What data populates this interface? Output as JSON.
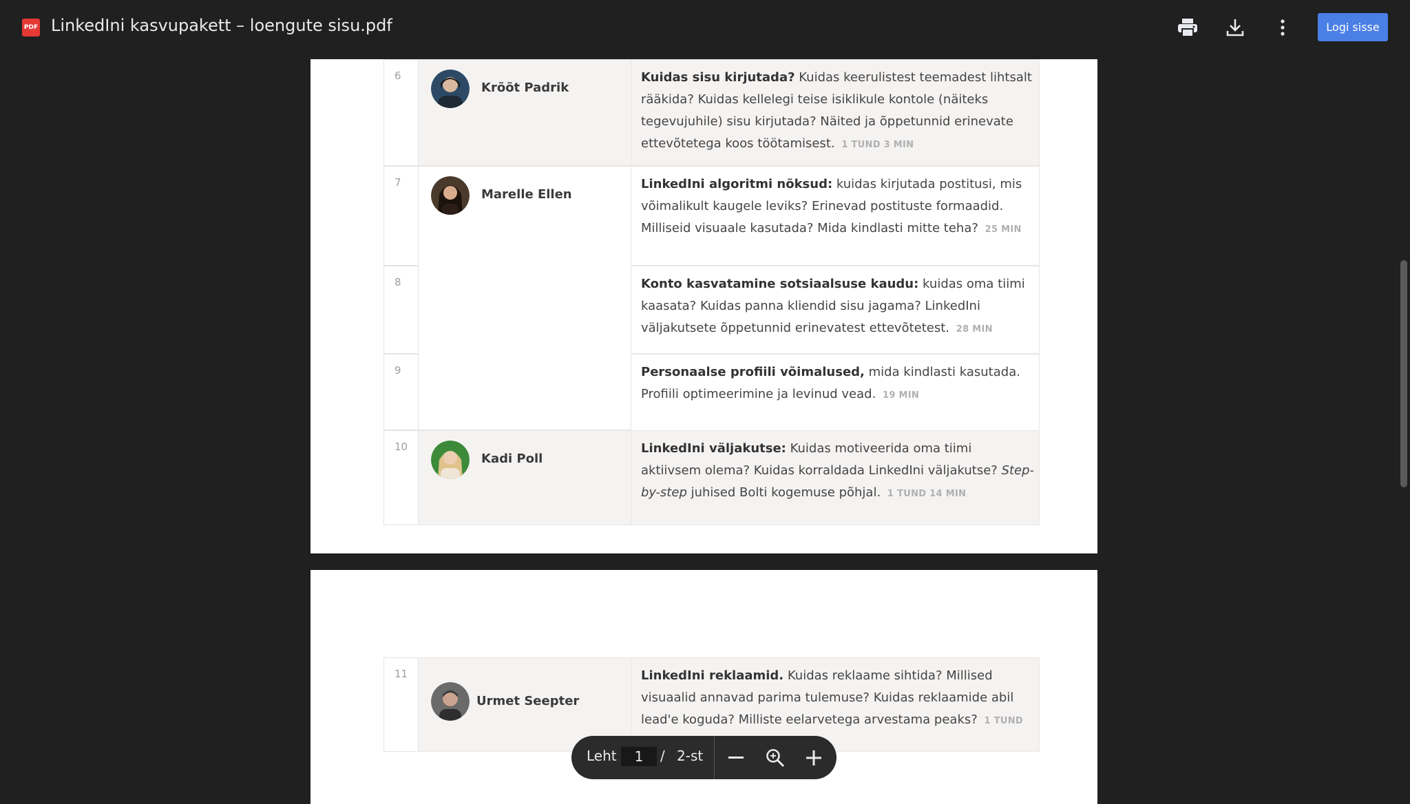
{
  "header": {
    "file_icon_text": "PDF",
    "title": "LinkedIni kasvupakett – loengute sisu.pdf",
    "print_icon": "print-icon",
    "download_icon": "download-icon",
    "more_icon": "more-vert-icon",
    "login_label": "Logi sisse"
  },
  "rows": [
    {
      "num": "6",
      "speaker": "Krõõt Padrik",
      "title": "Kuidas sisu kirjutada?",
      "text": " Kuidas keerulistest teemadest lihtsalt rääkida? Kuidas kellelegi teise isiklikule kontole (näiteks tegevujuhile) sisu kirjutada? Näited ja õppetunnid erinevate ettevõtetega koos töötamisest.",
      "duration": "1 TUND 3  MIN"
    },
    {
      "num": "7",
      "speaker": "Marelle Ellen",
      "title": "LinkedIni algoritmi nõksud:",
      "text": " kuidas kirjutada postitusi, mis võimalikult kaugele leviks? Erinevad postituste formaadid. Milliseid visuaale kasutada? Mida kindlasti mitte teha?",
      "duration": "25  MIN"
    },
    {
      "num": "8",
      "speaker": "",
      "title": "Konto kasvatamine sotsiaalsuse kaudu:",
      "text": " kuidas oma tiimi kaasata? Kuidas panna kliendid sisu jagama? LinkedIni väljakutsete õppetunnid erinevatest ettevõtetest.",
      "duration": "28  MIN"
    },
    {
      "num": "9",
      "speaker": "",
      "title": "Personaalse profiili võimalused,",
      "text": " mida kindlasti kasutada. Profiili optimeerimine ja levinud vead.",
      "duration": "19 MIN"
    },
    {
      "num": "10",
      "speaker": "Kadi Poll",
      "title": "LinkedIni väljakutse:",
      "text": " Kuidas motiveerida oma tiimi aktiivsem olema? Kuidas korraldada LinkedIni väljakutse? ",
      "italic": "Step-by-step",
      "text2": " juhised Bolti kogemuse põhjal.",
      "duration": "1 TUND 14  MIN"
    },
    {
      "num": "11",
      "speaker": "Urmet Seepter",
      "title": "LinkedIni reklaamid.",
      "text": " Kuidas reklaame sihtida? Millised visuaalid annavad parima tulemuse? Kuidas reklaamide abil lead'e koguda? Milliste eelarvetega arvestama peaks?",
      "duration": "1 TUND 22  MIN"
    }
  ],
  "toolbar": {
    "page_label": "Leht",
    "page_value": "1",
    "separator": "/",
    "total": "2-st",
    "zoom_out_icon": "minus-icon",
    "zoom_icon": "zoom-icon",
    "zoom_in_icon": "plus-icon"
  }
}
